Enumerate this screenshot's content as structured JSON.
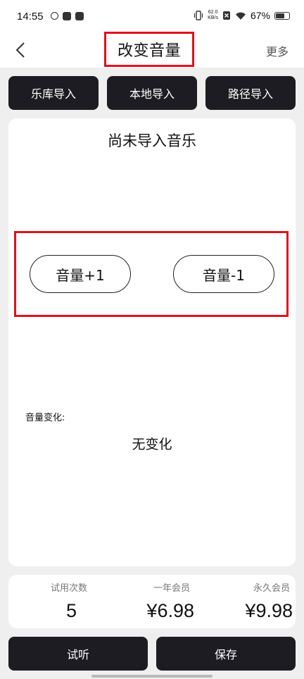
{
  "status_bar": {
    "time": "14:55",
    "net_speed_value": "62.0",
    "net_speed_unit": "KB/s",
    "battery_percent": "67%"
  },
  "header": {
    "title": "改变音量",
    "more_label": "更多"
  },
  "import_buttons": [
    {
      "label": "乐库导入"
    },
    {
      "label": "本地导入"
    },
    {
      "label": "路径导入"
    }
  ],
  "main": {
    "empty_title": "尚未导入音乐",
    "volume_up_label": "音量+1",
    "volume_down_label": "音量-1",
    "change_label": "音量变化:",
    "change_value": "无变化"
  },
  "pricing": {
    "trial_label": "试用次数",
    "trial_value": "5",
    "year_label": "一年会员",
    "year_value": "¥6.98",
    "forever_label": "永久会员",
    "forever_value": "¥9.98"
  },
  "actions": {
    "listen_label": "试听",
    "save_label": "保存"
  },
  "colors": {
    "highlight": "#e0121d",
    "button_dark": "#1d1c22",
    "background": "#efefef"
  }
}
